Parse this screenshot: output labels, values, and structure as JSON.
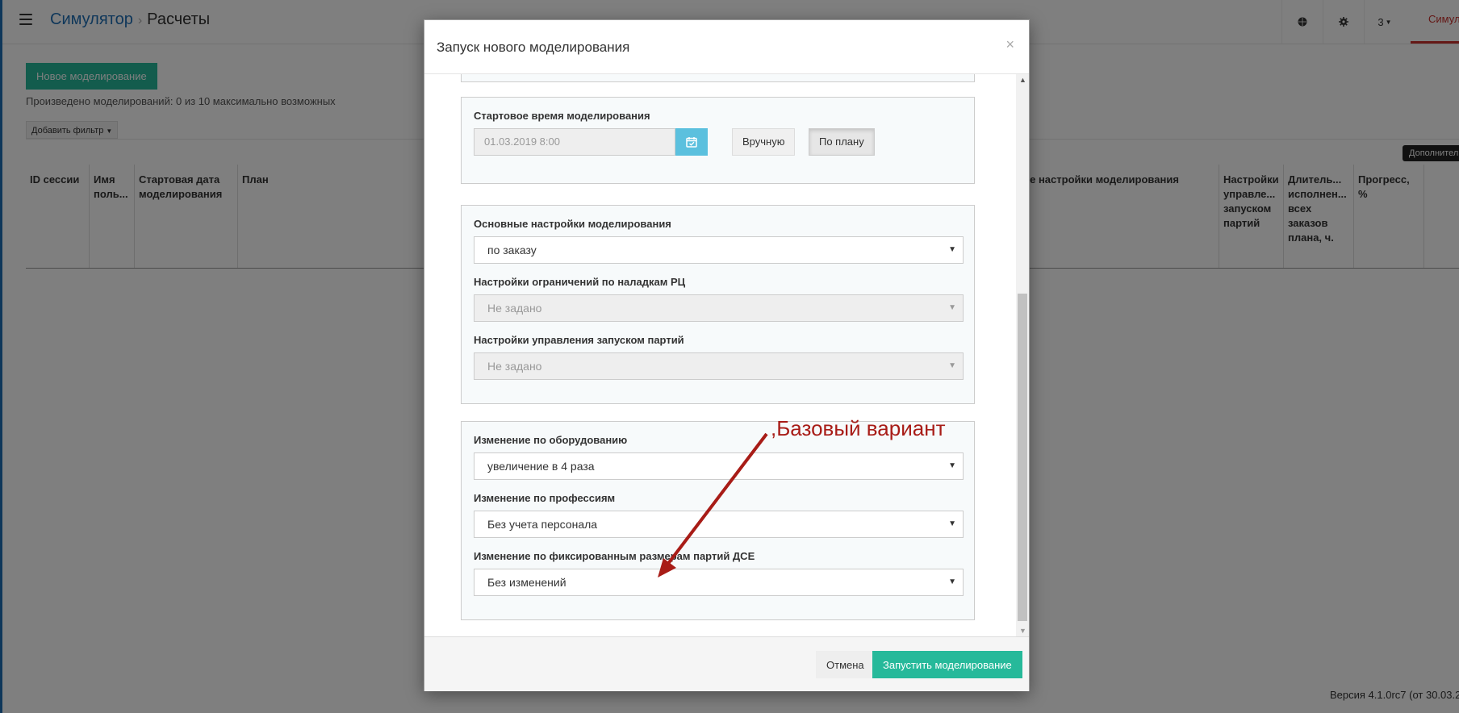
{
  "header": {
    "breadcrumb_link": "Симулятор",
    "breadcrumb_current": "Расчеты",
    "user_label": "3",
    "active_tab": "Симуля"
  },
  "page": {
    "new_button": "Новое моделирование",
    "count_text": "Произведено моделирований: 0 из 10 максимально возможных",
    "filter_button": "Добавить фильтр",
    "tooltip": "Дополнительн",
    "columns": [
      "ID сессии",
      "Имя поль...",
      "Стартовая дата моделирования",
      "План",
      "ые настройки моделирования",
      "Настройки управле... запуском партий",
      "Длитель... исполнен... всех заказов плана, ч.",
      "Прогресс, %"
    ],
    "version": "Версия 4.1.0rc7 (от 30.03.2"
  },
  "modal": {
    "title": "Запуск нового моделирования",
    "close": "×",
    "start_time_label": "Стартовое время моделирования",
    "start_time_value": "01.03.2019 8:00",
    "manual_button": "Вручную",
    "plan_button": "По плану",
    "main_settings_label": "Основные настройки моделирования",
    "main_settings_value": "по заказу",
    "setup_limits_label": "Настройки ограничений по наладкам РЦ",
    "setup_limits_value": "Не задано",
    "batch_control_label": "Настройки управления запуском партий",
    "batch_control_value": "Не задано",
    "equipment_label": "Изменение по оборудованию",
    "equipment_value": "увеличение в 4 раза",
    "professions_label": "Изменение по профессиям",
    "professions_value": "Без учета персонала",
    "batches_label": "Изменение по фиксированным размерам партий ДСЕ",
    "batches_value": "Без изменений",
    "cancel_button": "Отмена",
    "run_button": "Запустить моделирование"
  },
  "annotation": ",Базовый вариант",
  "colors": {
    "accent": "#26b99a",
    "link": "#1f6fb5",
    "annotation": "#a81c17",
    "date_button": "#5bc0de"
  }
}
